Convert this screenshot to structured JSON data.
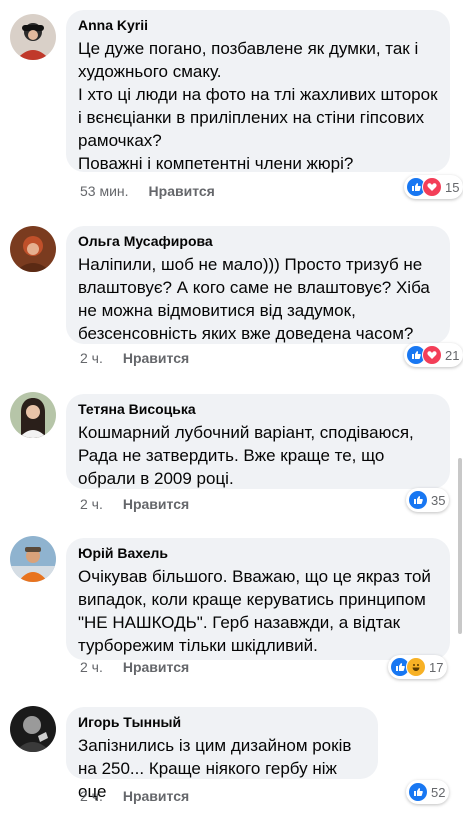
{
  "comments": [
    {
      "author": "Anna Kyrii",
      "text": "Це дуже погано, позбавлене як думки, так і художнього смаку.\nІ хто ці люди на фото на тлі жахливих шторок і вєнєціанки в приліплених на стіни гіпсових рамочках?\nПоважні і компетентні члени жюрі?",
      "time": "53 мин.",
      "like_label": "Нравится",
      "reaction_count": "15",
      "reactions": [
        "like-icon",
        "love-icon"
      ]
    },
    {
      "author": "Ольга Мусафирова",
      "text": "Наліпили, шоб не мало))) Просто тризуб не влаштовує? А кого саме не влаштовує? Хіба не можна відмовитися від задумок, безсенсовність яких вже доведена часом?",
      "time": "2 ч.",
      "like_label": "Нравится",
      "reaction_count": "21",
      "reactions": [
        "like-icon",
        "love-icon"
      ]
    },
    {
      "author": "Тетяна Висоцька",
      "text": "Кошмарний лубочний варіант, сподіваюся, Рада не затвердить. Вже краще те, що обрали в 2009 році.",
      "time": "2 ч.",
      "like_label": "Нравится",
      "reaction_count": "35",
      "reactions": [
        "like-icon"
      ]
    },
    {
      "author": "Юрій Вахель",
      "text": "Очікував більшого. Вважаю, що це якраз той випадок, коли краще керуватись принципом \"НЕ НАШКОДЬ\". Герб назавжди, а відтак турборежим тільки шкідливий.",
      "time": "2 ч.",
      "like_label": "Нравится",
      "reaction_count": "17",
      "reactions": [
        "like-icon",
        "haha-icon"
      ]
    },
    {
      "author": "Игорь Тынный",
      "text": "Запізнились із цим дизайном років на 250... Краще ніякого гербу ніж оце",
      "time": "2 ч.",
      "like_label": "Нравится",
      "reaction_count": "52",
      "reactions": [
        "like-icon"
      ]
    }
  ],
  "colors": {
    "bubble": "#f0f2f5",
    "like": "#1877f2",
    "love": "#f33e58",
    "haha": "#f7b125"
  }
}
